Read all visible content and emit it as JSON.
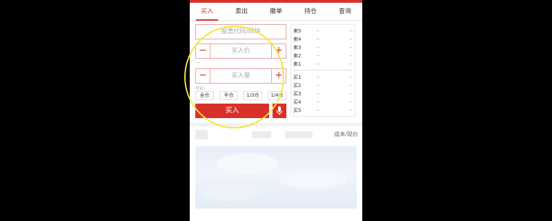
{
  "tabs": [
    "买入",
    "卖出",
    "撤单",
    "持仓",
    "查询"
  ],
  "form": {
    "code_placeholder": "股票代码/简拼",
    "price_placeholder": "买入价",
    "qty_placeholder": "买入量",
    "limit_low": "--",
    "limit_high": "--",
    "hint": "可买:",
    "positions": [
      "全仓",
      "半仓",
      "1/3仓",
      "1/4仓"
    ],
    "buy_label": "买入",
    "minus_symbol": "−",
    "plus_symbol": "+"
  },
  "order_book": {
    "asks": [
      {
        "label": "卖5",
        "price": "--",
        "volume": "--"
      },
      {
        "label": "卖4",
        "price": "--",
        "volume": "--"
      },
      {
        "label": "卖3",
        "price": "--",
        "volume": "--"
      },
      {
        "label": "卖2",
        "price": "--",
        "volume": "--"
      },
      {
        "label": "卖1",
        "price": "--",
        "volume": "--"
      }
    ],
    "bids": [
      {
        "label": "买1",
        "price": "--",
        "volume": "--"
      },
      {
        "label": "买2",
        "price": "--",
        "volume": "--"
      },
      {
        "label": "买3",
        "price": "--",
        "volume": "--"
      },
      {
        "label": "买4",
        "price": "--",
        "volume": "--"
      },
      {
        "label": "买5",
        "price": "--",
        "volume": "--"
      }
    ]
  },
  "holdings": {
    "cost_label": "成本/现价"
  },
  "colors": {
    "accent": "#d9302a",
    "highlight_circle": "#f3e63a"
  },
  "icons": {
    "mic": "microphone-icon"
  }
}
